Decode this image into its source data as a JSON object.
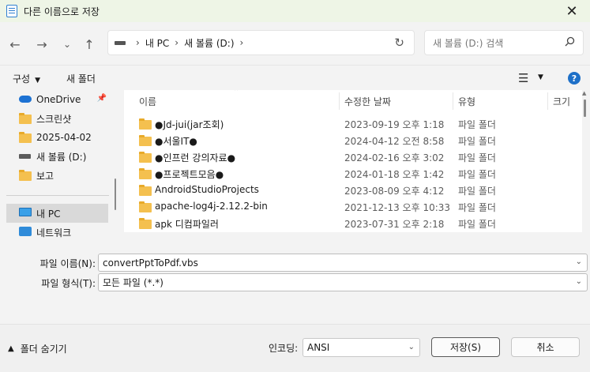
{
  "window": {
    "title": "다른 이름으로 저장",
    "close_glyph": "✕"
  },
  "nav": {
    "back": "←",
    "forward": "→",
    "recent": "⌄",
    "up": "↑",
    "breadcrumb": [
      "내 PC",
      "새 볼륨 (D:)"
    ],
    "refresh": "↻",
    "search_placeholder": "새 볼륨 (D:) 검색"
  },
  "toolbar": {
    "organize_label": "구성",
    "new_folder_label": "새 폴더",
    "help": "?"
  },
  "sidebar": {
    "items": [
      {
        "label": "OneDrive",
        "icon": "cloud-icon",
        "pinned": true
      },
      {
        "label": "스크린샷",
        "icon": "folder-icon"
      },
      {
        "label": "2025-04-02",
        "icon": "folder-icon"
      },
      {
        "label": "새 볼륨 (D:)",
        "icon": "drive-icon"
      },
      {
        "label": "보고",
        "icon": "folder-icon"
      },
      {
        "label": "내 PC",
        "icon": "pc-icon",
        "selected": true
      },
      {
        "label": "네트워크",
        "icon": "network-icon"
      }
    ]
  },
  "filelist": {
    "columns": [
      "이름",
      "수정한 날짜",
      "유형",
      "크기"
    ],
    "rows": [
      {
        "name": "●Jd-jui(jar조회)",
        "date": "2023-09-19 오후 1:18",
        "type": "파일 폴더"
      },
      {
        "name": "●서울IT●",
        "date": "2024-04-12 오전 8:58",
        "type": "파일 폴더"
      },
      {
        "name": "●인프런 강의자료●",
        "date": "2024-02-16 오후 3:02",
        "type": "파일 폴더"
      },
      {
        "name": "●프로젝트모음●",
        "date": "2024-01-18 오후 1:42",
        "type": "파일 폴더"
      },
      {
        "name": "AndroidStudioProjects",
        "date": "2023-08-09 오후 4:12",
        "type": "파일 폴더"
      },
      {
        "name": "apache-log4j-2.12.2-bin",
        "date": "2021-12-13 오후 10:33",
        "type": "파일 폴더"
      },
      {
        "name": "apk 디컴파일러",
        "date": "2023-07-31 오후 2:18",
        "type": "파일 폴더"
      }
    ]
  },
  "form": {
    "filename_label": "파일 이름(N):",
    "filename_value": "convertPptToPdf.vbs",
    "filetype_label": "파일 형식(T):",
    "filetype_value": "모든 파일  (*.*)"
  },
  "footer": {
    "hide_folders_label": "폴더 숨기기",
    "encoding_label": "인코딩:",
    "encoding_value": "ANSI",
    "save_label": "저장(S)",
    "cancel_label": "취소"
  }
}
